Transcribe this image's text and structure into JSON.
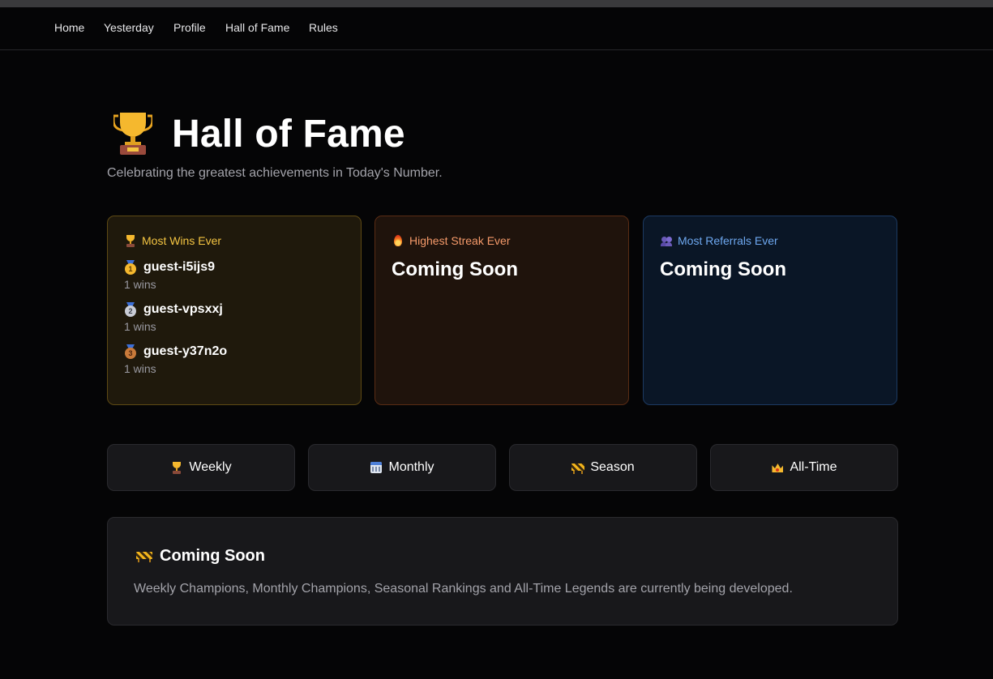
{
  "nav": {
    "items": [
      "Home",
      "Yesterday",
      "Profile",
      "Hall of Fame",
      "Rules"
    ]
  },
  "header": {
    "icon": "trophy-icon",
    "title": "Hall of Fame",
    "subtitle": "Celebrating the greatest achievements in Today's Number."
  },
  "cards": {
    "most_wins": {
      "icon": "trophy-icon",
      "title": "Most Wins Ever",
      "entries": [
        {
          "medal": "gold-medal-icon",
          "rank": "1",
          "name": "guest-i5ijs9",
          "wins": "1 wins"
        },
        {
          "medal": "silver-medal-icon",
          "rank": "2",
          "name": "guest-vpsxxj",
          "wins": "1 wins"
        },
        {
          "medal": "bronze-medal-icon",
          "rank": "3",
          "name": "guest-y37n2o",
          "wins": "1 wins"
        }
      ]
    },
    "highest_streak": {
      "icon": "fire-icon",
      "title": "Highest Streak Ever",
      "value": "Coming Soon"
    },
    "most_referrals": {
      "icon": "people-icon",
      "title": "Most Referrals Ever",
      "value": "Coming Soon"
    }
  },
  "tabs": [
    {
      "icon": "trophy-icon",
      "label": "Weekly"
    },
    {
      "icon": "calendar-icon",
      "label": "Monthly"
    },
    {
      "icon": "construction-icon",
      "label": "Season"
    },
    {
      "icon": "crown-icon",
      "label": "All-Time"
    }
  ],
  "notice": {
    "icon": "construction-icon",
    "title": "Coming Soon",
    "text": "Weekly Champions, Monthly Champions, Seasonal Rankings and All-Time Legends are currently being developed."
  },
  "colors": {
    "background": "#050506",
    "gold_accent": "#f5c542",
    "fire_accent": "#f59a6a",
    "blue_accent": "#6ea8f0",
    "muted_text": "#a3a3aa"
  }
}
